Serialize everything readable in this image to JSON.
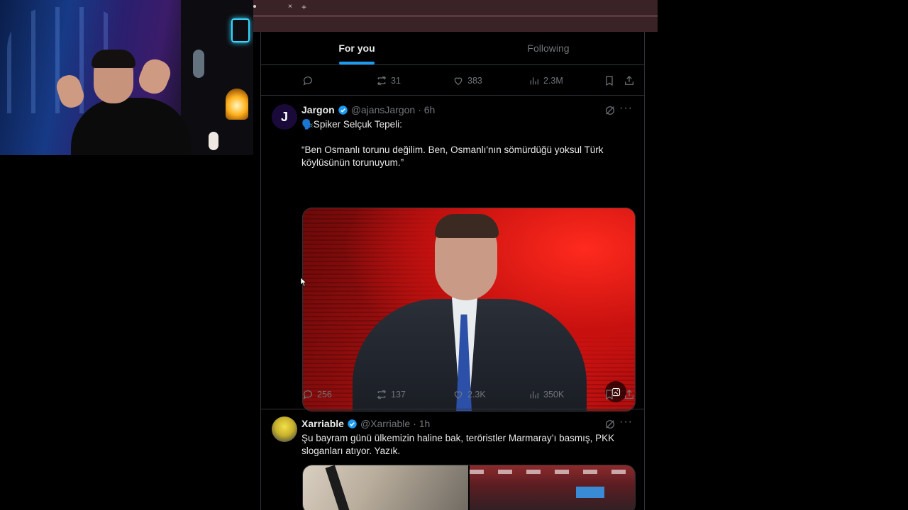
{
  "browser": {
    "tab_close": "×",
    "tab_new": "+"
  },
  "timeline": {
    "tabs": [
      {
        "label": "For you",
        "active": true
      },
      {
        "label": "Following",
        "active": false
      }
    ],
    "prev_post_stats": {
      "replies": "",
      "reposts": "31",
      "likes": "383",
      "views": "2.3M"
    },
    "posts": [
      {
        "name": "Jargon",
        "handle": "@ajansJargon",
        "time": "· 6h",
        "avatar_letter": "J",
        "avatar_color": "#2a0a5e",
        "line1": "🗣️Spiker Selçuk Tepeli:",
        "line2": "“Ben Osmanlı torunu değilim. Ben, Osmanlı'nın sömürdüğü yoksul Türk köylüsünün torunuyum.”",
        "stats": {
          "replies": "256",
          "reposts": "137",
          "likes": "2.3K",
          "views": "350K"
        }
      },
      {
        "name": "Xarriable",
        "handle": "@Xarriable",
        "time": "· 1h",
        "avatar_color": "#d8c93a",
        "text": "Şu bayram günü ülkemizin haline bak, teröristler Marmaray’ı basmış, PKK sloganları atıyor. Yazık."
      }
    ]
  },
  "colors": {
    "accent": "#1d9bf0",
    "muted": "#71767b",
    "text": "#e7e9ea",
    "border": "#2f3336"
  },
  "icons": [
    "reply-icon",
    "repost-icon",
    "like-icon",
    "views-icon",
    "bookmark-icon",
    "share-icon",
    "grok-icon",
    "more-icon",
    "verified-icon"
  ]
}
